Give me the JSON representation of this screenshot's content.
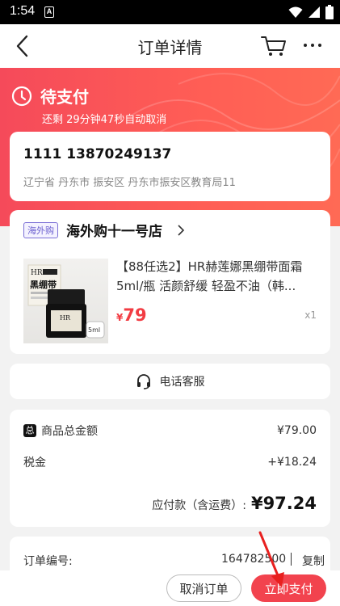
{
  "status_bar": {
    "time": "1:54",
    "notif_glyph": "A"
  },
  "nav": {
    "title": "订单详情"
  },
  "header": {
    "status": "待支付",
    "countdown": "还剩 29分钟47秒自动取消"
  },
  "address": {
    "name_phone": "1111 13870249137",
    "detail": "辽宁省 丹东市 振安区 丹东市振安区教育局11"
  },
  "shop": {
    "tag": "海外购",
    "name": "海外购十一号店",
    "product": {
      "title": "【88任选2】HR赫莲娜黑绷带面霜5ml/瓶 活颜舒缓 轻盈不油（韩...",
      "price_symbol": "¥",
      "price": "79",
      "qty": "x1",
      "img_brand": "HR",
      "img_text": "黑绷带",
      "img_badge": "5ml"
    }
  },
  "service": {
    "label": "电话客服"
  },
  "totals": {
    "badge": "总",
    "goods_label": "商品总金额",
    "goods_value": "¥79.00",
    "tax_label": "税金",
    "tax_value": "+¥18.24",
    "payable_label": "应付款（含运费）:",
    "payable_value": "¥97.24"
  },
  "order": {
    "label": "订单编号:",
    "number": "164782500",
    "copy": "复制"
  },
  "actions": {
    "cancel": "取消订单",
    "pay": "立即支付"
  },
  "colors": {
    "accent": "#f2434e",
    "header": "#ff5a57",
    "shop_tag": "#6a5fcf"
  }
}
